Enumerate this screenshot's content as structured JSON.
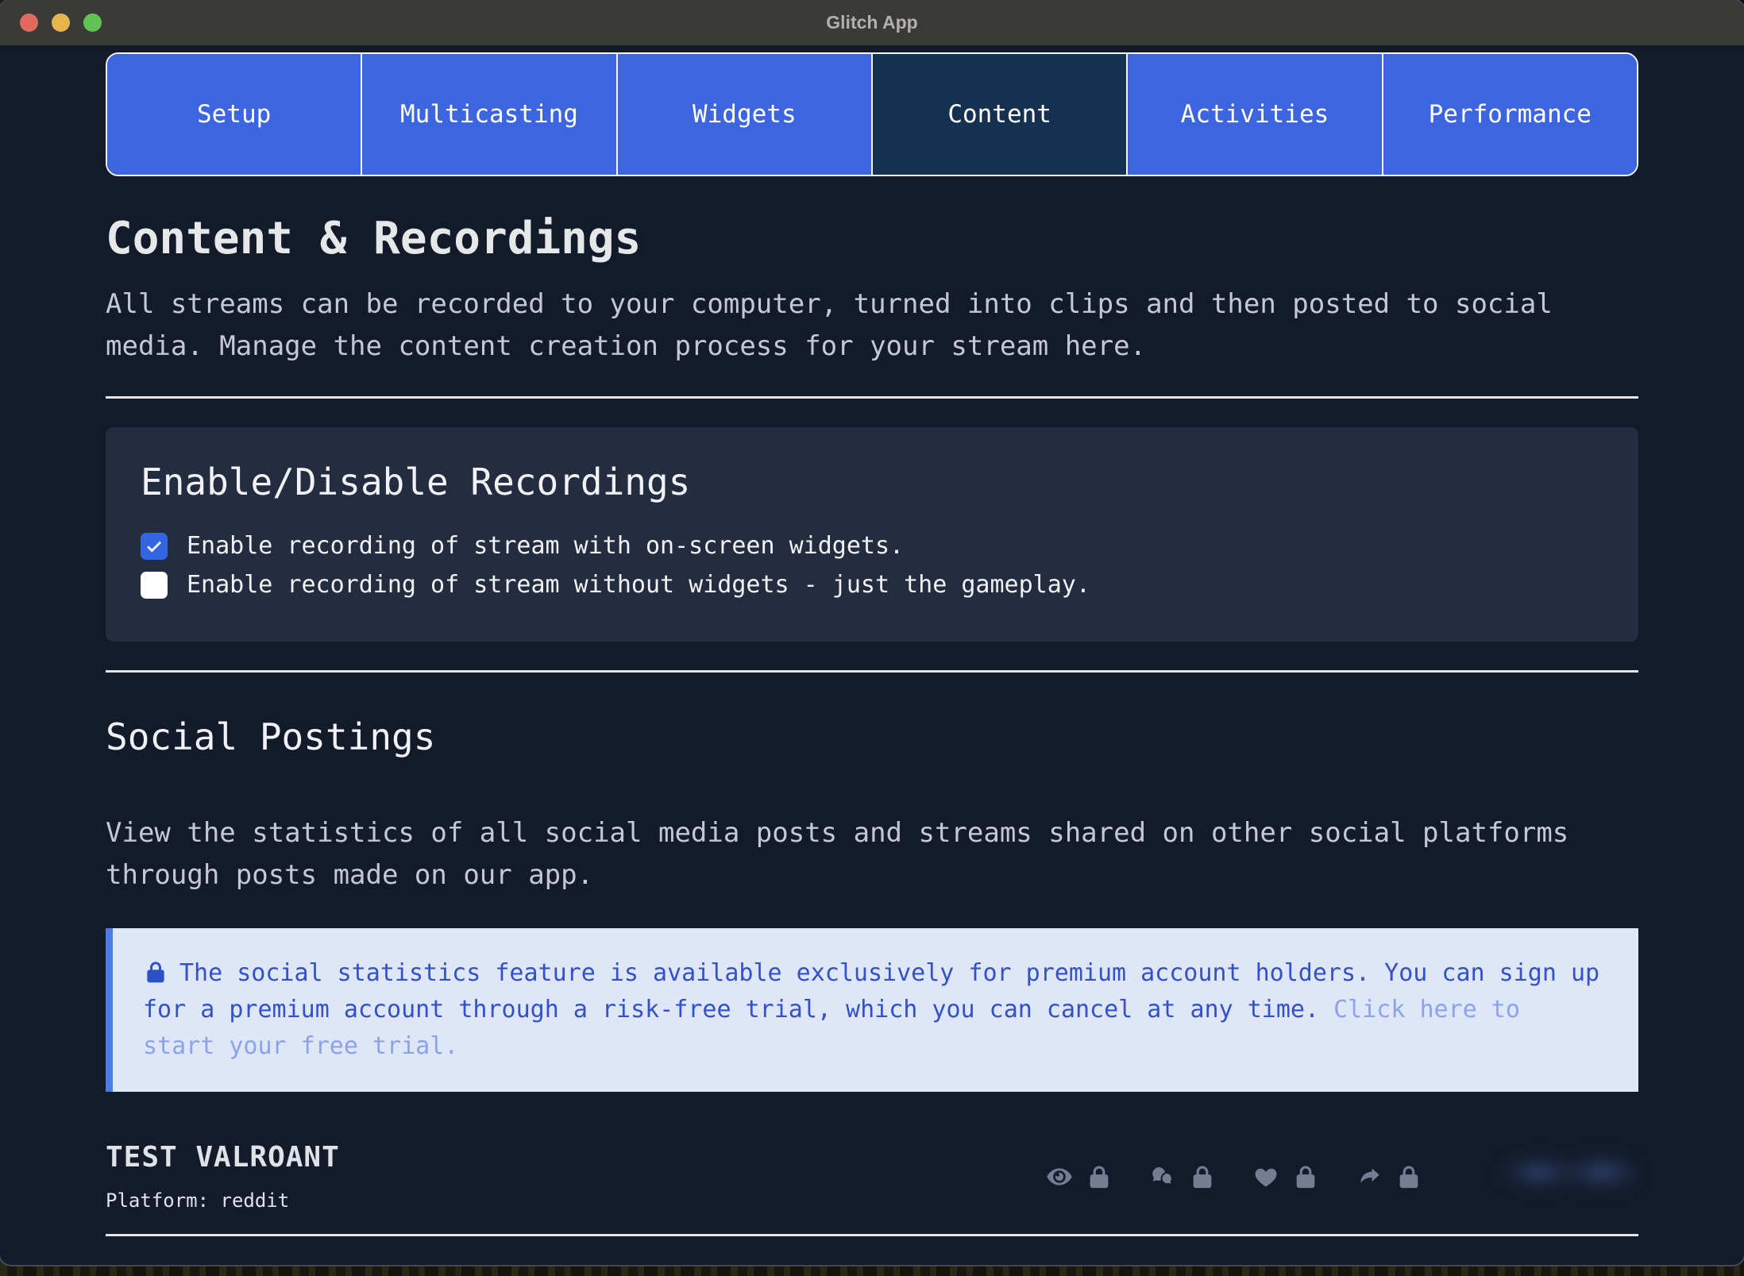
{
  "window": {
    "title": "Glitch App"
  },
  "tabs": [
    {
      "label": "Setup",
      "active": false
    },
    {
      "label": "Multicasting",
      "active": false
    },
    {
      "label": "Widgets",
      "active": false
    },
    {
      "label": "Content",
      "active": true
    },
    {
      "label": "Activities",
      "active": false
    },
    {
      "label": "Performance",
      "active": false
    }
  ],
  "page": {
    "title": "Content & Recordings",
    "intro": "All streams can be recorded to your computer, turned into clips and then posted to social media. Manage the content creation process for your stream here."
  },
  "recordings": {
    "title": "Enable/Disable Recordings",
    "options": [
      {
        "label": "Enable recording of stream with on-screen widgets.",
        "checked": true
      },
      {
        "label": "Enable recording of stream without widgets - just the gameplay.",
        "checked": false
      }
    ]
  },
  "social": {
    "title": "Social Postings",
    "description": "View the statistics of all social media posts and streams shared on other social platforms through posts made on our app.",
    "premium_notice": {
      "icon": "lock-icon",
      "text": "The social statistics feature is available exclusively for premium account holders. You can sign up for a premium account through a risk-free trial, which you can cancel at any time.",
      "link_text": "Click here to start your free trial."
    },
    "post": {
      "title": "TEST VALROANT",
      "platform_label": "Platform: reddit",
      "stat_groups": [
        [
          "eye-icon",
          "lock-icon"
        ],
        [
          "comments-icon",
          "lock-icon"
        ],
        [
          "heart-icon",
          "lock-icon"
        ],
        [
          "share-icon",
          "lock-icon"
        ]
      ]
    }
  },
  "colors": {
    "accent_blue": "#3d65e0",
    "active_tab": "#16304f",
    "page_background": "#131b2b",
    "panel_background": "#232d3f",
    "notice_background": "#dee6f8",
    "notice_border": "#4b7de9",
    "notice_text": "#3351c9",
    "notice_link": "#8ba4e8",
    "checkbox_checked": "#3365e2",
    "stat_icon_gray": "#747e93"
  }
}
